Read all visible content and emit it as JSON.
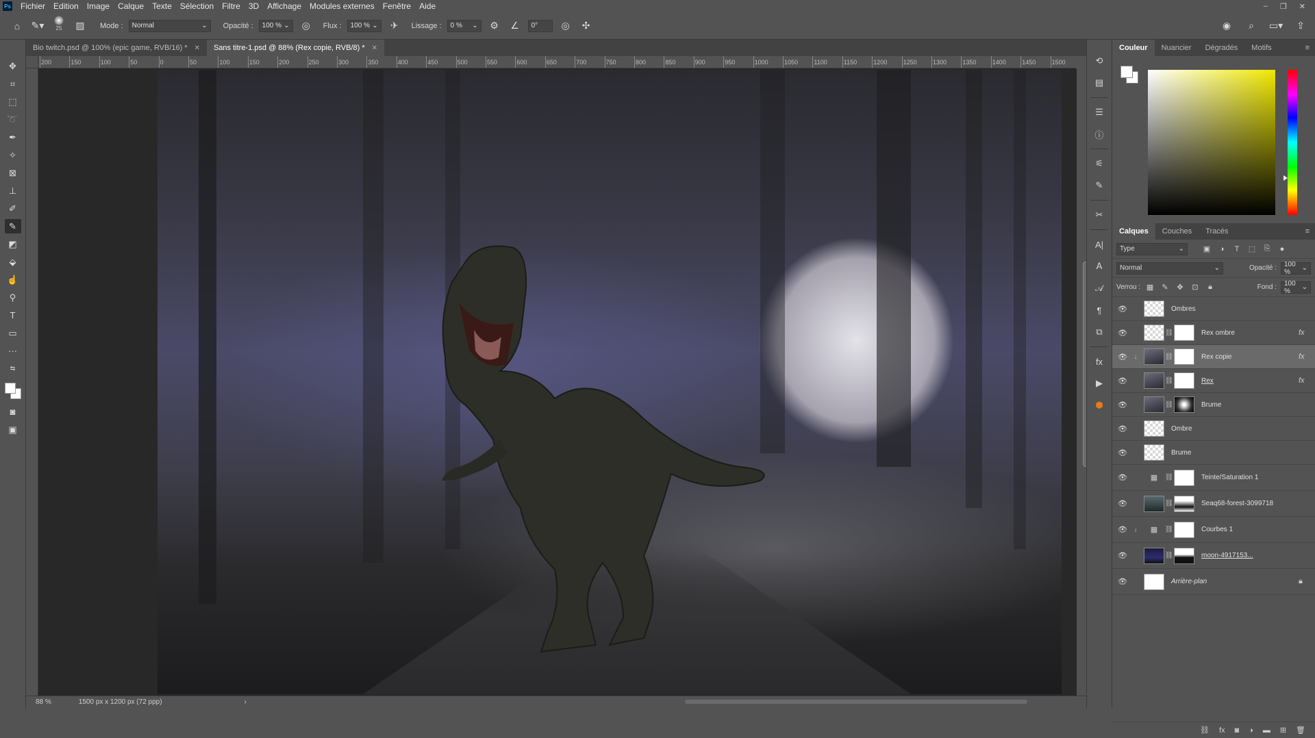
{
  "app": {
    "logo": "Ps",
    "menu": [
      "Fichier",
      "Edition",
      "Image",
      "Calque",
      "Texte",
      "Sélection",
      "Filtre",
      "3D",
      "Affichage",
      "Modules externes",
      "Fenêtre",
      "Aide"
    ],
    "window_controls": [
      "–",
      "❐",
      "✕"
    ]
  },
  "options": {
    "brush_size": "25",
    "mode_label": "Mode :",
    "mode_value": "Normal",
    "opacity_label": "Opacité :",
    "opacity_value": "100 %",
    "flow_label": "Flux :",
    "flow_value": "100 %",
    "smoothing_label": "Lissage :",
    "smoothing_value": "0 %",
    "angle_value": "0°"
  },
  "tabs": [
    {
      "label": "Bio twitch.psd @ 100% (epic game, RVB/16) *",
      "active": false
    },
    {
      "label": "Sans titre-1.psd @ 88% (Rex copie, RVB/8) *",
      "active": true
    }
  ],
  "ruler": {
    "ticks": [
      "200",
      "150",
      "100",
      "50",
      "0",
      "50",
      "100",
      "150",
      "200",
      "250",
      "300",
      "350",
      "400",
      "450",
      "500",
      "550",
      "600",
      "650",
      "700",
      "750",
      "800",
      "850",
      "900",
      "950",
      "1000",
      "1050",
      "1100",
      "1150",
      "1200",
      "1250",
      "1300",
      "1350",
      "1400",
      "1450",
      "1500"
    ]
  },
  "status": {
    "zoom": "88 %",
    "doc_info": "1500 px x 1200 px (72 ppp)",
    "arrow": "›"
  },
  "color_panel": {
    "tabs": [
      "Couleur",
      "Nuancier",
      "Dégradés",
      "Motifs"
    ],
    "foreground": "#ffffff",
    "background": "#ffffff"
  },
  "layers_panel": {
    "tabs": [
      "Calques",
      "Couches",
      "Tracés"
    ],
    "filter_value": "Type",
    "blend_mode": "Normal",
    "opacity_label": "Opacité :",
    "opacity_value": "100 %",
    "lock_label": "Verrou :",
    "fill_label": "Fond :",
    "fill_value": "100 %",
    "layers": [
      {
        "name": "Ombres",
        "thumb": "checker",
        "mask": "",
        "fx": "",
        "clip": "",
        "selected": false,
        "style": ""
      },
      {
        "name": "Rex ombre",
        "thumb": "checker",
        "mask": "white",
        "fx": "fx",
        "clip": "",
        "selected": false,
        "style": ""
      },
      {
        "name": "Rex copie",
        "thumb": "dark",
        "mask": "white",
        "fx": "fx",
        "clip": "↓",
        "selected": true,
        "style": ""
      },
      {
        "name": "Rex",
        "thumb": "dark",
        "mask": "white",
        "fx": "fx",
        "clip": "",
        "selected": false,
        "style": "underline"
      },
      {
        "name": "Brume",
        "thumb": "dark",
        "mask": "glow",
        "fx": "",
        "clip": "",
        "selected": false,
        "style": ""
      },
      {
        "name": "Ombre",
        "thumb": "checker",
        "mask": "",
        "fx": "",
        "clip": "",
        "selected": false,
        "style": ""
      },
      {
        "name": "Brume",
        "thumb": "checker",
        "mask": "",
        "fx": "",
        "clip": "",
        "selected": false,
        "style": ""
      },
      {
        "name": "Teinte/Saturation 1",
        "thumb": "adj",
        "mask": "white",
        "fx": "",
        "clip": "",
        "selected": false,
        "style": ""
      },
      {
        "name": "Seaq68-forest-3099718",
        "thumb": "forest",
        "mask": "maskforest",
        "fx": "",
        "clip": "",
        "selected": false,
        "style": ""
      },
      {
        "name": "Courbes 1",
        "thumb": "adj",
        "mask": "white",
        "fx": "",
        "clip": "↓",
        "selected": false,
        "style": ""
      },
      {
        "name": "moon-4917153...",
        "thumb": "moon",
        "mask": "maskmoon",
        "fx": "",
        "clip": "",
        "selected": false,
        "style": "underline"
      },
      {
        "name": "Arrière-plan",
        "thumb": "white",
        "mask": "",
        "fx": "",
        "clip": "",
        "selected": false,
        "style": "italic",
        "locked": true
      }
    ]
  }
}
